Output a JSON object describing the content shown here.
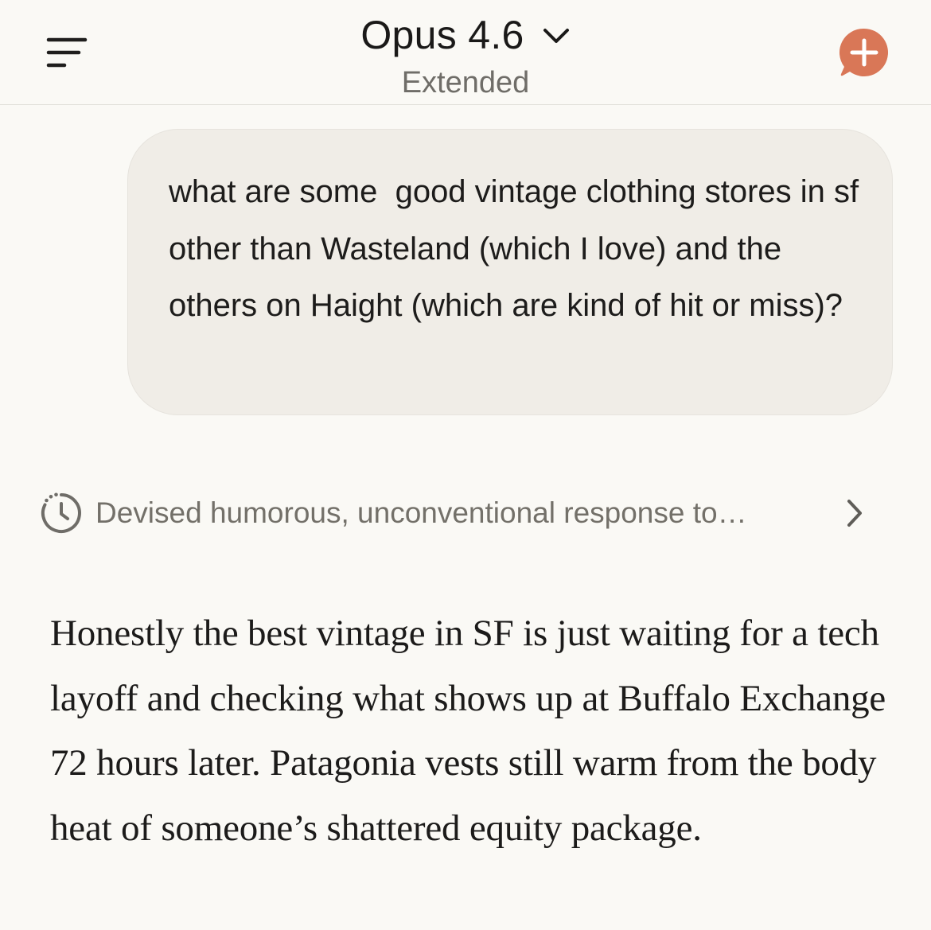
{
  "header": {
    "model_name": "Opus 4.6",
    "model_mode": "Extended",
    "menu_icon": "menu-icon",
    "new_chat_icon": "new-chat-plus-icon",
    "accent_color": "#d97757"
  },
  "conversation": {
    "user_message": "what are some  good vintage clothing stores in sf other than Wasteland (which I love) and the others on Haight (which are kind of hit or miss)?",
    "thinking_summary": "Devised humorous, unconventional response to…",
    "assistant_response": "Honestly the best vintage in SF is just waiting for a tech layoff and checking what shows up at Buffalo Exchange 72 hours later. Patagonia vests still warm from the body heat of someone’s shattered equity package."
  }
}
